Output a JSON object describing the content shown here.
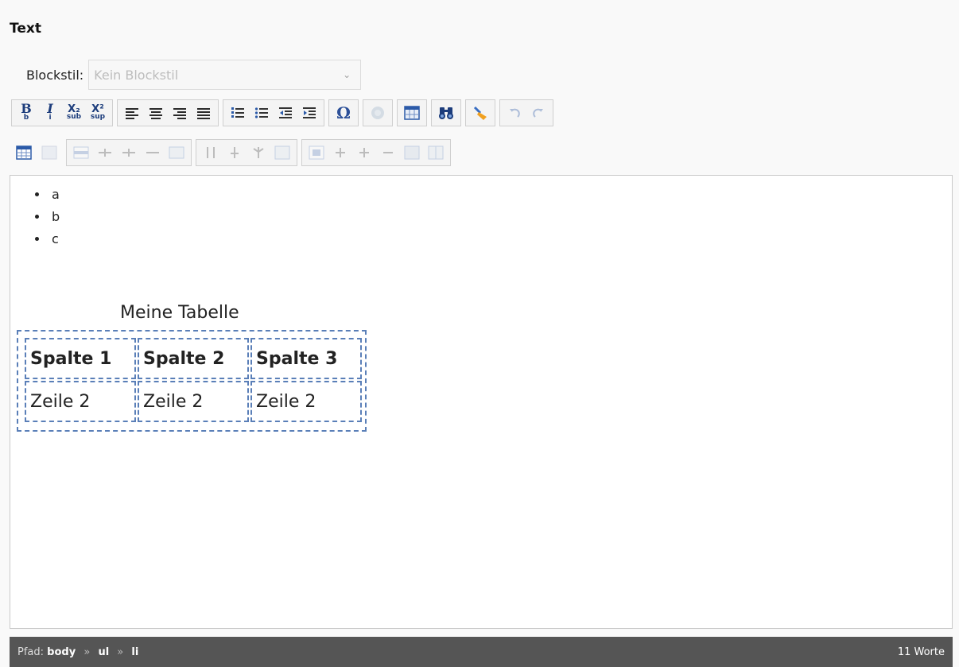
{
  "field": {
    "title": "Text"
  },
  "blockstyle": {
    "label": "Blockstil:",
    "value": "Kein Blockstil"
  },
  "toolbar_icons": {
    "row1": [
      "bold-icon",
      "italic-icon",
      "subscript-icon",
      "superscript-icon",
      "align-left-icon",
      "align-center-icon",
      "align-right-icon",
      "align-justify-icon",
      "ordered-list-icon",
      "unordered-list-icon",
      "outdent-icon",
      "indent-icon",
      "special-char-icon",
      "image-icon",
      "insert-table-icon",
      "find-replace-icon",
      "cleanup-icon",
      "undo-icon",
      "redo-icon"
    ],
    "row2": [
      "table-icon",
      "table-properties-icon",
      "row-properties-icon",
      "row-insert-before-icon",
      "row-insert-after-icon",
      "row-delete-icon",
      "row-split-icon",
      "column-properties-icon",
      "column-insert-before-icon",
      "column-insert-after-icon",
      "column-delete-icon",
      "cell-properties-icon",
      "cell-insert-before-icon",
      "cell-insert-after-icon",
      "cell-delete-icon",
      "cell-merge-icon",
      "cell-split-icon"
    ]
  },
  "toolbar": {
    "bold": "B",
    "bold_sub": "b",
    "italic": "I",
    "italic_sub": "i",
    "sub_glyph": "X₂",
    "sub_label": "sub",
    "sup_glyph": "X²",
    "sup_label": "sup",
    "special_char": "Ω"
  },
  "editor": {
    "list_items": [
      "a",
      "b",
      "c"
    ],
    "table": {
      "caption": "Meine Tabelle",
      "headers": [
        "Spalte 1",
        "Spalte 2",
        "Spalte 3"
      ],
      "rows": [
        [
          "Zeile 2",
          "Zeile 2",
          "Zeile 2"
        ]
      ]
    }
  },
  "statusbar": {
    "path_label": "Pfad:",
    "path": [
      "body",
      "ul",
      "li"
    ],
    "separator": "»",
    "word_count": "11 Worte"
  },
  "colors": {
    "statusbar_bg": "#555555",
    "table_border": "#5a7fb8",
    "icon_blue": "#1d3d7c"
  }
}
